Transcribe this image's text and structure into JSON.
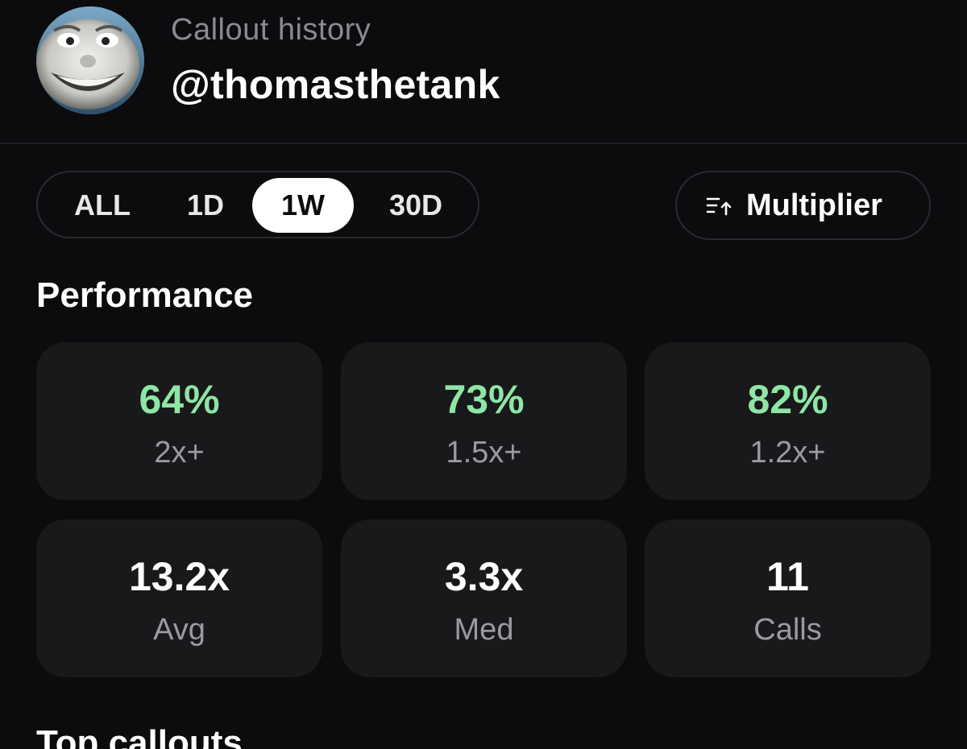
{
  "header": {
    "subtitle": "Callout history",
    "handle": "@thomasthetank"
  },
  "range_tabs": {
    "items": [
      {
        "label": "ALL",
        "active": false
      },
      {
        "label": "1D",
        "active": false
      },
      {
        "label": "1W",
        "active": true
      },
      {
        "label": "30D",
        "active": false
      }
    ]
  },
  "sort": {
    "label": "Multiplier",
    "icon": "sort-ascending-icon"
  },
  "performance": {
    "title": "Performance",
    "hit_rates": [
      {
        "value": "64%",
        "label": "2x+"
      },
      {
        "value": "73%",
        "label": "1.5x+"
      },
      {
        "value": "82%",
        "label": "1.2x+"
      }
    ],
    "summary": [
      {
        "value": "13.2x",
        "label": "Avg"
      },
      {
        "value": "3.3x",
        "label": "Med"
      },
      {
        "value": "11",
        "label": "Calls"
      }
    ]
  },
  "top_callouts": {
    "title": "Top callouts"
  },
  "colors": {
    "background": "#0c0c0e",
    "card": "#19191c",
    "accent_green": "#8ee6a4",
    "muted_text": "#9a9aa0",
    "active_tab_bg": "#ffffff"
  }
}
